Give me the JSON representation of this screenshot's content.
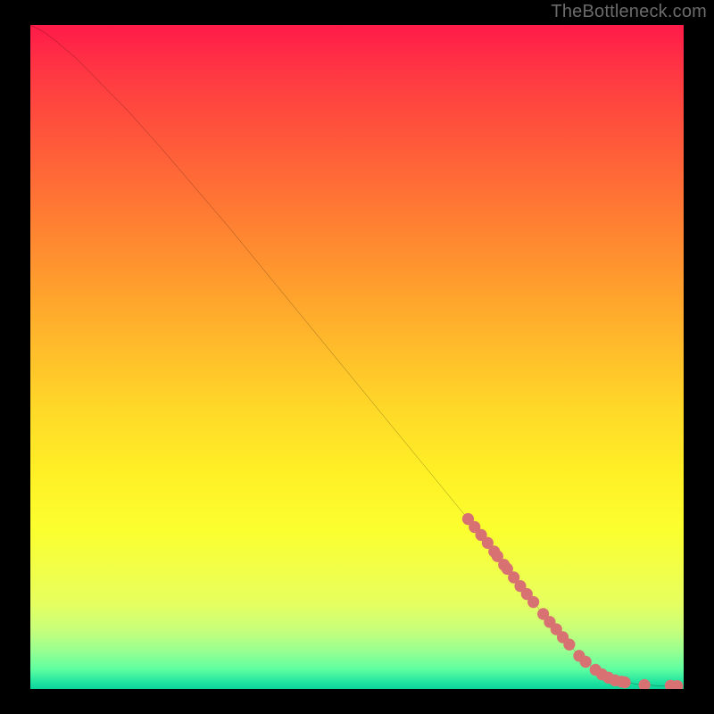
{
  "attribution": "TheBottleneck.com",
  "chart_data": {
    "type": "line",
    "title": "",
    "xlabel": "",
    "ylabel": "",
    "xlim": [
      0,
      100
    ],
    "ylim": [
      0,
      100
    ],
    "curve": [
      {
        "x": 0,
        "y": 100
      },
      {
        "x": 2,
        "y": 99
      },
      {
        "x": 4,
        "y": 97.5
      },
      {
        "x": 7,
        "y": 95
      },
      {
        "x": 10,
        "y": 92
      },
      {
        "x": 15,
        "y": 87
      },
      {
        "x": 20,
        "y": 81.5
      },
      {
        "x": 30,
        "y": 70
      },
      {
        "x": 40,
        "y": 58
      },
      {
        "x": 50,
        "y": 46
      },
      {
        "x": 60,
        "y": 34
      },
      {
        "x": 70,
        "y": 22
      },
      {
        "x": 75,
        "y": 15.5
      },
      {
        "x": 80,
        "y": 9.5
      },
      {
        "x": 84,
        "y": 5
      },
      {
        "x": 87,
        "y": 2.5
      },
      {
        "x": 90,
        "y": 1.2
      },
      {
        "x": 93,
        "y": 0.7
      },
      {
        "x": 96,
        "y": 0.5
      },
      {
        "x": 100,
        "y": 0.4
      }
    ],
    "marker_color": "#d87272",
    "markers": [
      {
        "x": 67,
        "y": 25.6
      },
      {
        "x": 68,
        "y": 24.4
      },
      {
        "x": 69,
        "y": 23.2
      },
      {
        "x": 70,
        "y": 22.0
      },
      {
        "x": 71,
        "y": 20.7
      },
      {
        "x": 71.5,
        "y": 20.0
      },
      {
        "x": 72.5,
        "y": 18.7
      },
      {
        "x": 73,
        "y": 18.1
      },
      {
        "x": 74,
        "y": 16.8
      },
      {
        "x": 75,
        "y": 15.5
      },
      {
        "x": 76,
        "y": 14.3
      },
      {
        "x": 77,
        "y": 13.1
      },
      {
        "x": 78.5,
        "y": 11.3
      },
      {
        "x": 79.5,
        "y": 10.1
      },
      {
        "x": 80.5,
        "y": 9.0
      },
      {
        "x": 81.5,
        "y": 7.8
      },
      {
        "x": 82.5,
        "y": 6.7
      },
      {
        "x": 84,
        "y": 5.0
      },
      {
        "x": 85,
        "y": 4.1
      },
      {
        "x": 86.5,
        "y": 2.9
      },
      {
        "x": 87.5,
        "y": 2.2
      },
      {
        "x": 88.5,
        "y": 1.7
      },
      {
        "x": 89.5,
        "y": 1.3
      },
      {
        "x": 90.5,
        "y": 1.1
      },
      {
        "x": 91,
        "y": 1.0
      },
      {
        "x": 94,
        "y": 0.6
      },
      {
        "x": 98,
        "y": 0.5
      },
      {
        "x": 99,
        "y": 0.45
      }
    ]
  }
}
